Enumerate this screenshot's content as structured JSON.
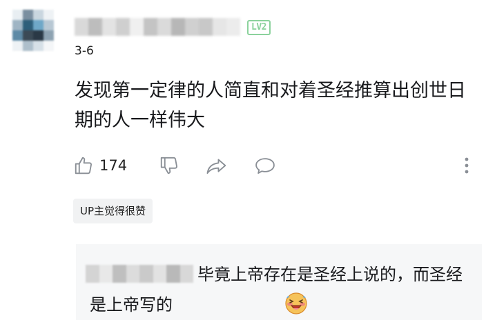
{
  "comment": {
    "level": "LV2",
    "date": "3-6",
    "text": "发现第一定律的人简直和对着圣经推算出创世日期的人一样伟大",
    "like_count": "174",
    "up_liked_label": "UP主觉得很赞"
  },
  "reply": {
    "text": "毕竟上帝存在是圣经上说的，而圣经是上帝写的"
  },
  "icons": {
    "like": "thumbs-up-icon",
    "dislike": "thumbs-down-icon",
    "share": "share-icon",
    "reply": "comment-icon",
    "more": "more-vertical-icon",
    "emoji": "laughing-face-emoji-icon"
  },
  "colors": {
    "level_badge": "#8bd29c",
    "up_liked_bg": "#f1f2f3",
    "reply_bg": "#f6f7f8",
    "icon": "#9499a0"
  }
}
